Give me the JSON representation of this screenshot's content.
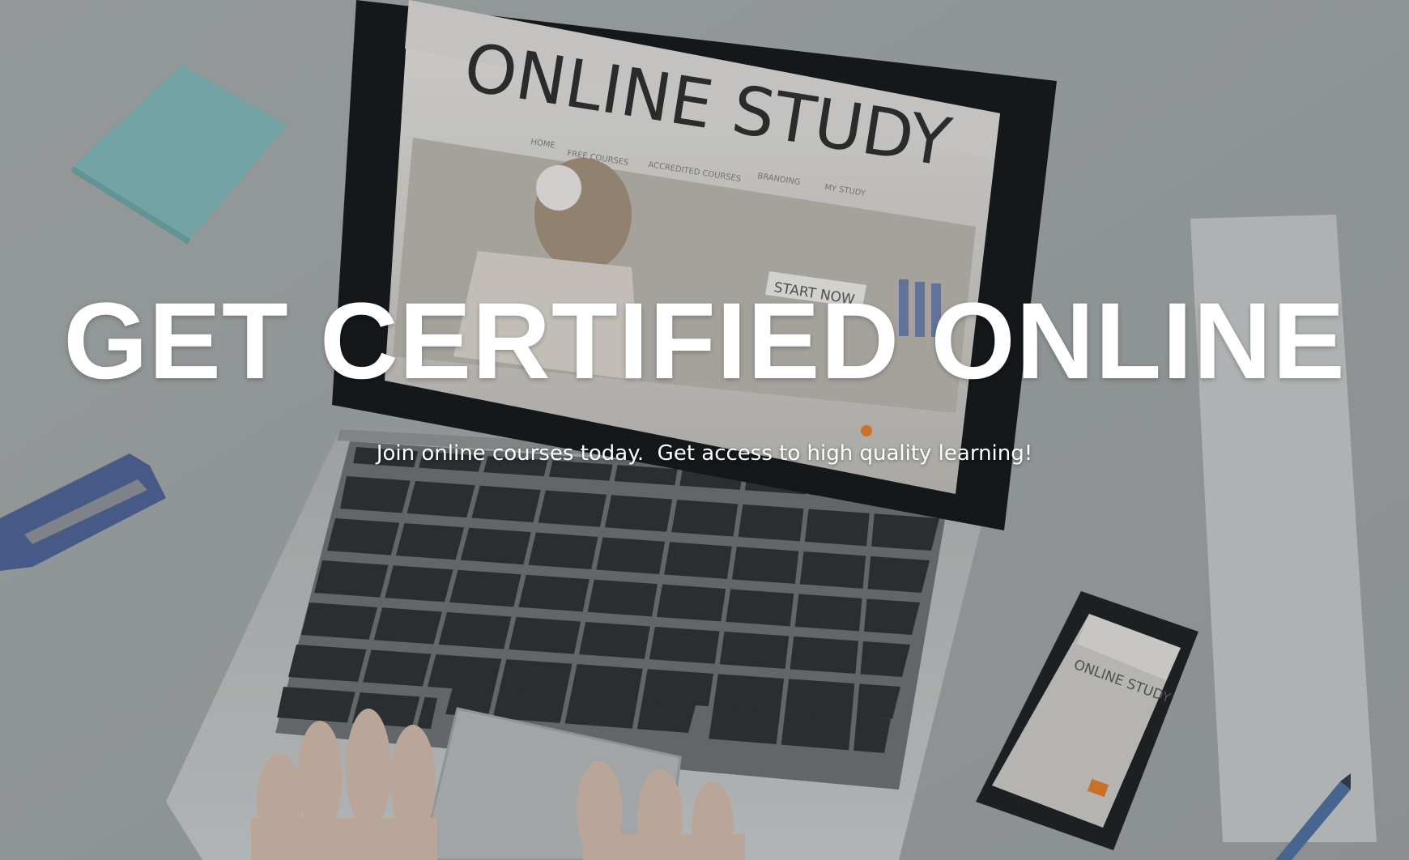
{
  "hero": {
    "title": "GET CERTIFIED ONLINE",
    "subtitle": "Join online courses today.  Get access to high quality learning!",
    "image": {
      "screen_heading": "ONLINE STUDY",
      "screen_nav": [
        "HOME",
        "FREE COURSES",
        "ACCREDITED COURSES",
        "BRANDING",
        "MY STUDY"
      ],
      "screen_button": "START NOW",
      "phone_heading": "ONLINE STUDY"
    }
  },
  "colors": {
    "text": "#ffffff",
    "desk": "#c9cbcb",
    "laptop": "#b8babb",
    "screen_bezel": "#111416",
    "sticky_note": "#8fc9cc",
    "stapler": "#4f6aa8",
    "accent": "#e07a2a"
  }
}
